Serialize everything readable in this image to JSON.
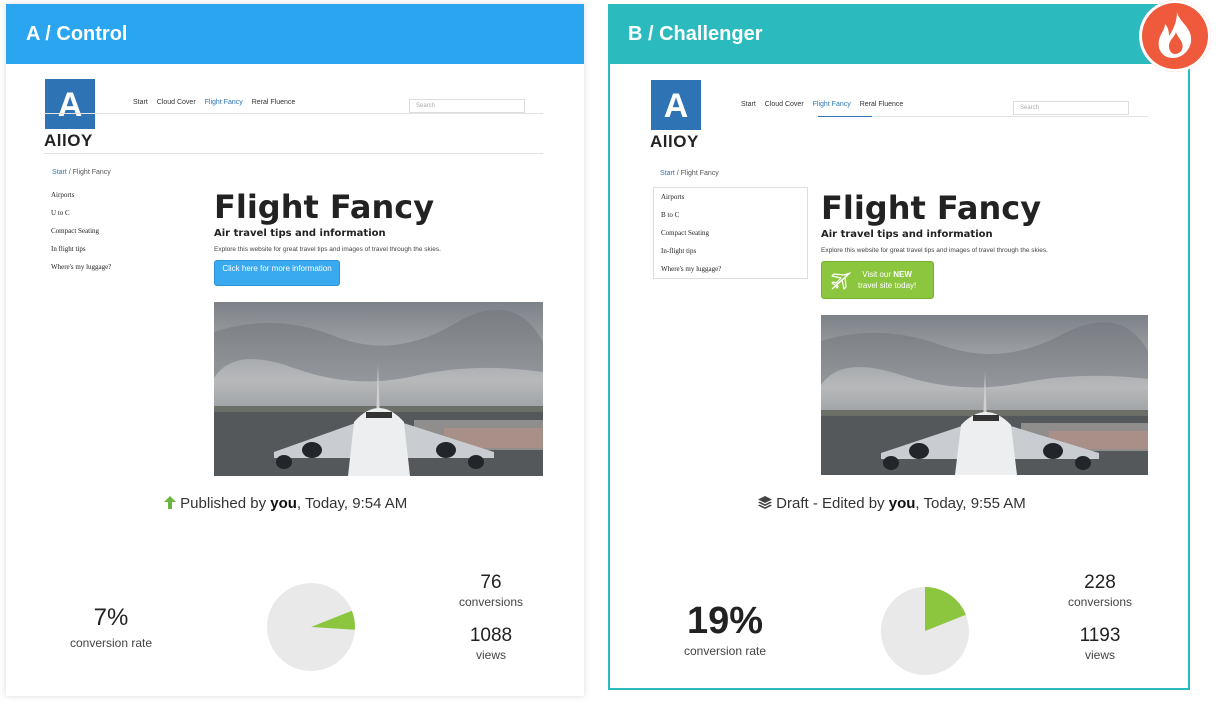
{
  "variants": [
    {
      "id": "A",
      "header": "A / Control",
      "status": {
        "prefix": "Published by",
        "user": "you",
        "suffix": ", Today, 9:54 AM",
        "icon": "arrow-up-icon"
      },
      "site": {
        "logo_letter": "A",
        "logo_word": "AllOY",
        "nav": [
          "Start",
          "Cloud Cover",
          "Flight Fancy",
          "Reral Fluence"
        ],
        "nav_active": "Flight Fancy",
        "search_placeholder": "Search",
        "breadcrumb": {
          "home": "Start",
          "sep": "/",
          "current": "Flight Fancy"
        },
        "sidebar": [
          "Airports",
          "U to C",
          "Compact Seating",
          "In flight tips",
          "Where's my luggage?"
        ],
        "title": "Flight Fancy",
        "subtitle": "Air travel tips and information",
        "description": "Explore this website for great travel tips and images of travel through the skies.",
        "cta": "Click here for more information"
      },
      "conversion_rate": "7%",
      "conversion_rate_label": "conversion rate",
      "conversions": "76",
      "conversions_label": "conversions",
      "views": "1088",
      "views_label": "views",
      "pie_fraction": 0.07
    },
    {
      "id": "B",
      "header": "B / Challenger",
      "status": {
        "prefix": "Draft - Edited by",
        "user": "you",
        "suffix": ", Today, 9:55 AM",
        "icon": "layers-icon"
      },
      "site": {
        "logo_letter": "A",
        "logo_word": "AllOY",
        "nav": [
          "Start",
          "Cloud Cover",
          "Flight Fancy",
          "Reral Fluence"
        ],
        "nav_active": "Flight Fancy",
        "search_placeholder": "Search",
        "breadcrumb": {
          "home": "Start",
          "sep": "/",
          "current": "Flight Fancy"
        },
        "sidebar": [
          "Airports",
          "B to C",
          "Compact Seating",
          "In-flight tips",
          "Where's my luggage?"
        ],
        "title": "Flight Fancy",
        "subtitle": "Air travel tips and information",
        "description": "Explore this website for great travel tips and images of travel through the skies.",
        "cta_line1_prefix": "Visit our",
        "cta_line1_bold": "NEW",
        "cta_line2": "travel site today!"
      },
      "conversion_rate": "19%",
      "conversion_rate_label": "conversion rate",
      "conversions": "228",
      "conversions_label": "conversions",
      "views": "1193",
      "views_label": "views",
      "pie_fraction": 0.19
    }
  ],
  "colors": {
    "control_header": "#2aa5ef",
    "challenger_header": "#2bbbbf",
    "pie_fill": "#8cc63f",
    "pie_bg": "#e9e9e9",
    "badge": "#ef5a3c"
  },
  "badge_icon": "flame-icon"
}
